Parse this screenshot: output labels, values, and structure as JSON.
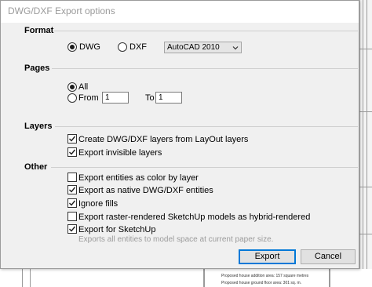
{
  "window": {
    "title": "DWG/DXF Export options"
  },
  "format": {
    "heading": "Format",
    "options": [
      {
        "label": "DWG",
        "selected": true
      },
      {
        "label": "DXF",
        "selected": false
      }
    ],
    "version_selected": "AutoCAD 2010"
  },
  "pages": {
    "heading": "Pages",
    "all_label": "All",
    "all_selected": true,
    "from_label": "From",
    "from_value": "1",
    "to_label": "To",
    "to_value": "1"
  },
  "layers": {
    "heading": "Layers",
    "items": [
      {
        "label": "Create DWG/DXF layers from LayOut layers",
        "checked": true
      },
      {
        "label": "Export invisible layers",
        "checked": true
      }
    ]
  },
  "other": {
    "heading": "Other",
    "items": [
      {
        "label": "Export entities as color by layer",
        "checked": false
      },
      {
        "label": "Export as native DWG/DXF entities",
        "checked": true
      },
      {
        "label": "Ignore fills",
        "checked": true
      },
      {
        "label": "Export raster-rendered SketchUp models as hybrid-rendered",
        "checked": false
      },
      {
        "label": "Export for SketchUp",
        "checked": true
      }
    ],
    "hint": "Exports all entities to model space at current paper size."
  },
  "buttons": {
    "export_label": "Export",
    "cancel_label": "Cancel"
  },
  "background": {
    "notes": [
      "Proposed house addition area: 157 square metres",
      "Proposed house ground floor area: 301 sq. m."
    ]
  },
  "colors": {
    "focus_border": "#0078d7",
    "hint_text": "#9b9b9b",
    "dialog_bg": "#f0f0f0"
  }
}
